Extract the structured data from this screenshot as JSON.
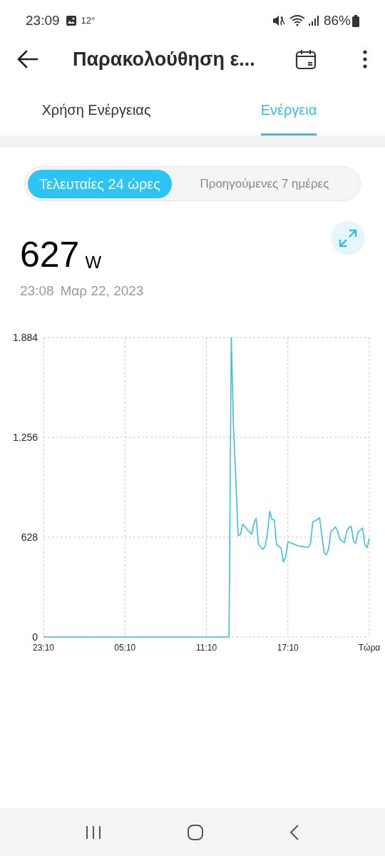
{
  "status_bar": {
    "time": "23:09",
    "temperature": "12°",
    "battery": "86%"
  },
  "app_bar": {
    "title": "Παρακολούθηση ε..."
  },
  "tabs": [
    {
      "label": "Χρήση Ενέργειας",
      "selected": false
    },
    {
      "label": "Ενέργεια",
      "selected": true
    }
  ],
  "range_toggle": [
    {
      "label": "Τελευταίες 24 ώρες",
      "selected": true
    },
    {
      "label": "Προηγούμενες 7 ημέρες",
      "selected": false
    }
  ],
  "reading": {
    "value": "627",
    "unit": "W",
    "time": "23:08",
    "date": "Μαρ 22, 2023"
  },
  "chart": {
    "chart_data": {
      "type": "line",
      "ylim": [
        0,
        1884
      ],
      "yticks": [
        {
          "value": 0,
          "label": "0"
        },
        {
          "value": 628,
          "label": "628"
        },
        {
          "value": 1256,
          "label": "1.256"
        },
        {
          "value": 1884,
          "label": "1.884"
        }
      ],
      "categories": [
        "23:10",
        null,
        null,
        null,
        null,
        null,
        null,
        null,
        null,
        null,
        null,
        null,
        null,
        null,
        null,
        null,
        null,
        null,
        null,
        null,
        null,
        null,
        null,
        null,
        null,
        null,
        null,
        null,
        null,
        null,
        null,
        null,
        null,
        null,
        null,
        null,
        "05:10",
        null,
        null,
        null,
        null,
        null,
        null,
        null,
        null,
        null,
        null,
        null,
        null,
        null,
        null,
        null,
        null,
        null,
        null,
        null,
        null,
        null,
        null,
        null,
        null,
        null,
        null,
        null,
        null,
        null,
        null,
        null,
        null,
        null,
        null,
        null,
        "11:10",
        null,
        null,
        null,
        null,
        null,
        null,
        null,
        null,
        null,
        null,
        null,
        null,
        null,
        null,
        null,
        null,
        null,
        null,
        null,
        null,
        null,
        null,
        null,
        null,
        null,
        null,
        null,
        null,
        null,
        null,
        null,
        null,
        null,
        null,
        null,
        "17:10",
        null,
        null,
        null,
        null,
        null,
        null,
        null,
        null,
        null,
        null,
        null,
        null,
        null,
        null,
        null,
        null,
        null,
        null,
        null,
        null,
        null,
        null,
        null,
        null,
        null,
        null,
        null,
        null,
        null,
        null,
        null,
        null,
        null,
        null,
        null,
        "Τώρα"
      ],
      "series": [
        {
          "color": "#3cc0e0",
          "values": [
            0,
            0,
            0,
            0,
            0,
            0,
            0,
            0,
            0,
            0,
            0,
            0,
            0,
            0,
            0,
            0,
            0,
            0,
            0,
            0,
            0,
            0,
            0,
            0,
            0,
            0,
            0,
            0,
            0,
            0,
            0,
            0,
            0,
            0,
            0,
            0,
            0,
            0,
            0,
            0,
            0,
            0,
            0,
            0,
            0,
            0,
            0,
            0,
            0,
            0,
            0,
            0,
            0,
            0,
            0,
            0,
            0,
            0,
            0,
            0,
            0,
            0,
            0,
            0,
            0,
            0,
            0,
            0,
            0,
            0,
            0,
            0,
            0,
            0,
            0,
            0,
            0,
            0,
            0,
            0,
            0,
            0,
            0,
            1882,
            1300,
            992,
            640,
            643,
            709,
            693,
            677,
            661,
            646,
            714,
            746,
            582,
            566,
            550,
            573,
            658,
            790,
            740,
            736,
            579,
            570,
            560,
            473,
            505,
            598,
            594,
            588,
            582,
            576,
            572,
            570,
            568,
            566,
            564,
            586,
            726,
            730,
            740,
            749,
            638,
            530,
            517,
            555,
            661,
            676,
            692,
            663,
            615,
            604,
            594,
            667,
            687,
            696,
            604,
            589,
            659,
            673,
            686,
            582,
            562,
            620
          ]
        }
      ]
    }
  }
}
